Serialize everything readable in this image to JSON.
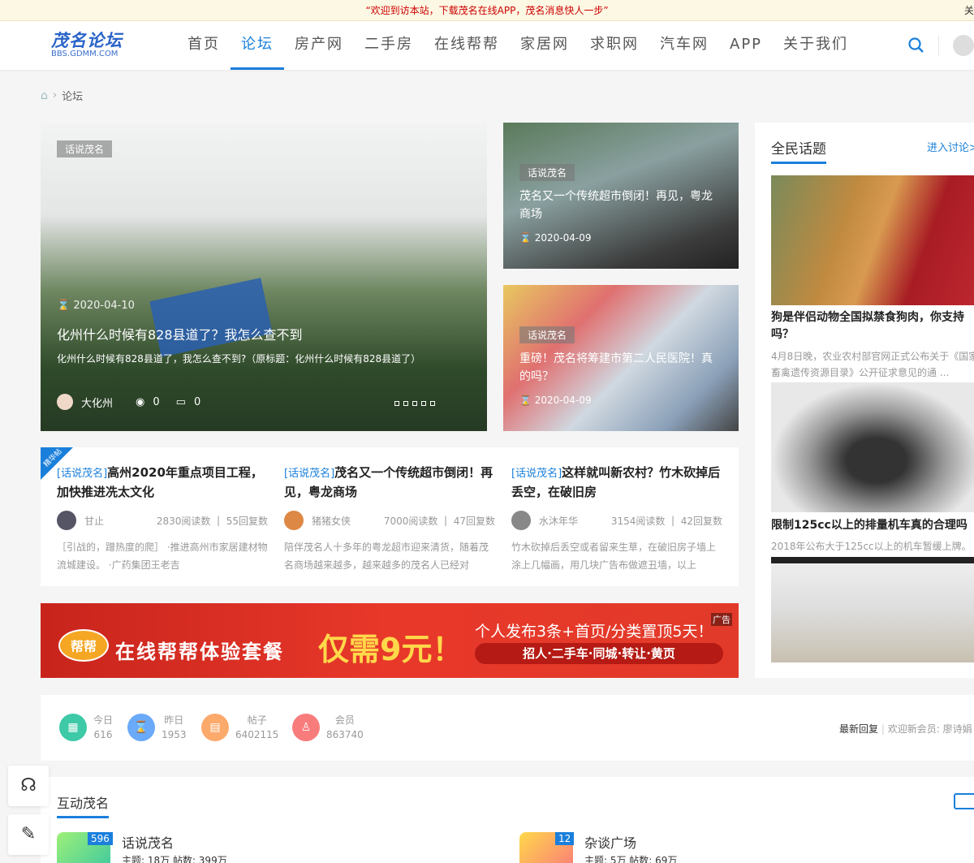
{
  "topbar": {
    "notice": "“欢迎到访本站，下载茂名在线APP，茂名消息快人一步”",
    "close": "关"
  },
  "logo": {
    "title": "茂名论坛",
    "subtitle": "BBS.GDMM.COM"
  },
  "nav": [
    "首页",
    "论坛",
    "房产网",
    "二手房",
    "在线帮帮",
    "家居网",
    "求职网",
    "汽车网",
    "APP",
    "关于我们"
  ],
  "breadcrumb": {
    "current": "论坛"
  },
  "hero": {
    "tag": "话说茂名",
    "date": "2020-04-10",
    "title": "化州什么时候有828县道了？我怎么查不到",
    "summary": "化州什么时候有828县道了，我怎么查不到?（原标题：化州什么时候有828县道了）",
    "author": "大化州",
    "views": "0",
    "comments": "0"
  },
  "side_cards": [
    {
      "tag": "话说茂名",
      "title": "茂名又一个传统超市倒闭！再见，粤龙商场",
      "date": "2020-04-09"
    },
    {
      "tag": "话说茂名",
      "title": "重磅！茂名将筹建市第二人民医院！真的吗？",
      "date": "2020-04-09"
    }
  ],
  "hot": {
    "badge": "精华帖",
    "items": [
      {
        "cat": "[话说茂名]",
        "title": "高州2020年重点项目工程，加快推进冼太文化",
        "author": "甘止",
        "reads": "2830阅读数",
        "replies": "55回复数",
        "desc": "［引战的，蹭热度的爬］ ·推进高州市家居建材物流城建设。 ·广药集团王老吉"
      },
      {
        "cat": "[话说茂名]",
        "title": "茂名又一个传统超市倒闭！再见，粤龙商场",
        "author": "猪猪女侠",
        "reads": "7000阅读数",
        "replies": "47回复数",
        "desc": "陪伴茂名人十多年的粤龙超市迎来清货，随着茂名商场越来越多，越来越多的茂名人已经对"
      },
      {
        "cat": "[话说茂名]",
        "title": "这样就叫新农村？竹木砍掉后丢空，在破旧房",
        "author": "水沐年华",
        "reads": "3154阅读数",
        "replies": "42回复数",
        "desc": "竹木砍掉后丢空或者留来生草，在破旧房子墙上涂上几幅画，用几块广告布做遮丑墙，以上"
      }
    ]
  },
  "banner": {
    "ad": "广告",
    "logo": "帮帮",
    "main": "在线帮帮体验套餐",
    "price": "仅需9元！",
    "line1": "个人发布3条+首页/分类置顶5天！",
    "line2": "招人·二手车·同城·转让·黄页"
  },
  "topics": {
    "title": "全民话题",
    "more": "进入讨论>",
    "items": [
      {
        "title": "狗是伴侣动物全国拟禁食狗肉，你支持吗？",
        "desc": "4月8日晚，农业农村部官网正式公布关于《国家畜禽遗传资源目录》公开征求意见的通 ..."
      },
      {
        "title": "限制125cc以上的排量机车真的合理吗",
        "desc": "2018年公布大于125cc以上的机车暂缓上牌。"
      }
    ]
  },
  "stats": [
    {
      "label": "今日",
      "value": "616",
      "color": "#3ec9a7"
    },
    {
      "label": "昨日",
      "value": "1953",
      "color": "#6aaaf8"
    },
    {
      "label": "帖子",
      "value": "6402115",
      "color": "#fca96c"
    },
    {
      "label": "会员",
      "value": "863740",
      "color": "#f87c7c"
    }
  ],
  "stats_right": {
    "latest": "最新回复",
    "welcome": "欢迎新会员: 廖诗娟"
  },
  "section": {
    "title": "互动茂名",
    "forums": [
      {
        "name": "话说茂名",
        "count": "596",
        "meta": "主题: 18万 帖数: 399万"
      },
      {
        "name": "杂谈广场",
        "count": "12",
        "meta": "主题: 5万 帖数: 69万"
      }
    ]
  }
}
